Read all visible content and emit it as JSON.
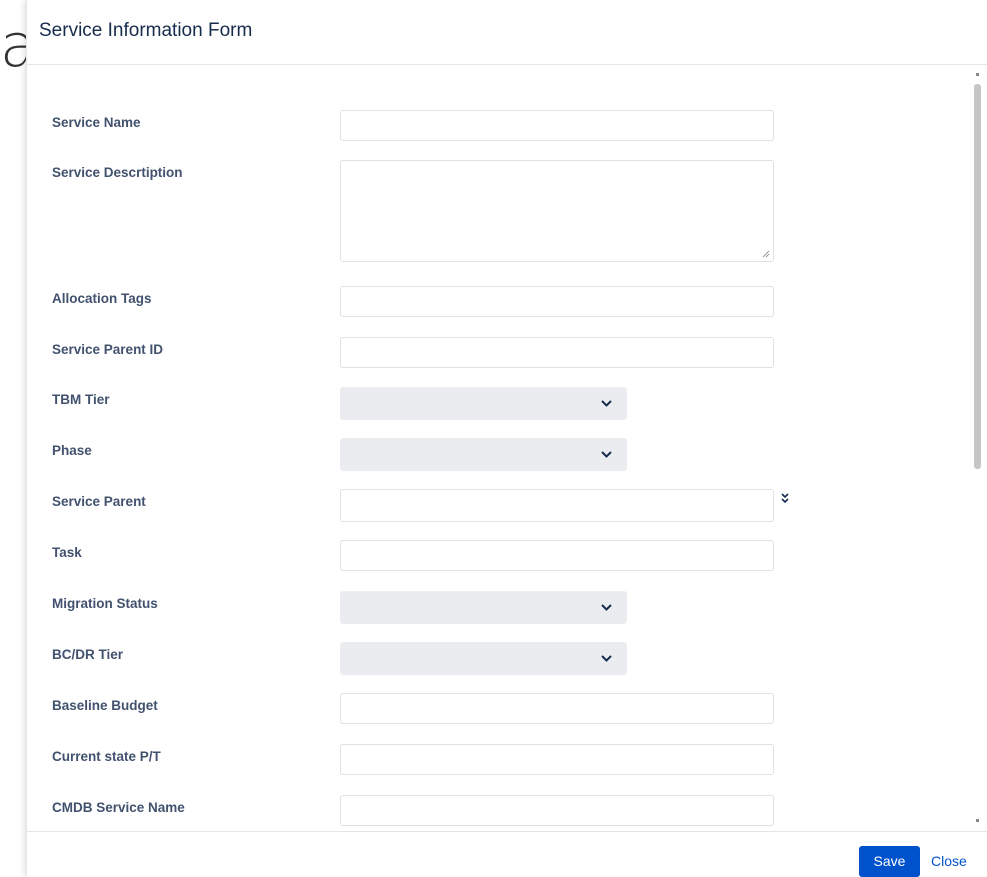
{
  "background_letter": "a",
  "dialog": {
    "title": "Service Information Form"
  },
  "form": {
    "fields": [
      {
        "label": "Service Name",
        "type": "text",
        "value": ""
      },
      {
        "label": "Service Descrtiption",
        "type": "textarea",
        "value": ""
      },
      {
        "label": "Allocation Tags",
        "type": "text",
        "value": ""
      },
      {
        "label": "Service Parent ID",
        "type": "text",
        "value": ""
      },
      {
        "label": "TBM Tier",
        "type": "select",
        "value": ""
      },
      {
        "label": "Phase",
        "type": "select",
        "value": ""
      },
      {
        "label": "Service Parent",
        "type": "text-expand",
        "value": ""
      },
      {
        "label": "Task",
        "type": "text",
        "value": ""
      },
      {
        "label": "Migration Status",
        "type": "select",
        "value": ""
      },
      {
        "label": "BC/DR Tier",
        "type": "select",
        "value": ""
      },
      {
        "label": "Baseline Budget",
        "type": "text",
        "value": ""
      },
      {
        "label": "Current state P/T",
        "type": "text",
        "value": ""
      },
      {
        "label": "CMDB Service Name",
        "type": "text",
        "value": ""
      }
    ]
  },
  "footer": {
    "save_label": "Save",
    "close_label": "Close"
  },
  "colors": {
    "primary": "#0052cc",
    "label": "#42526e",
    "title": "#172b4d",
    "select_bg": "#ebecf0"
  },
  "icons": {
    "select_chevron": "chevron-down-icon",
    "expand": "double-chevron-down-icon",
    "resize": "resize-handle-icon"
  }
}
